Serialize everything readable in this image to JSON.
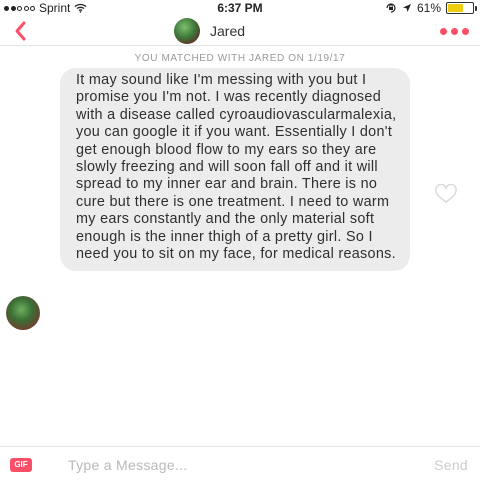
{
  "status_bar": {
    "carrier": "Sprint",
    "time": "6:37 PM",
    "battery_text": "61%",
    "battery_level": 0.61,
    "battery_color": "#f2cc0f",
    "icons": [
      "signal-dots-icon",
      "wifi-icon",
      "rotation-lock-icon",
      "location-arrow-icon",
      "battery-icon"
    ]
  },
  "header": {
    "name": "Jared",
    "accent_color": "#ff4e67",
    "back_icon": "chevron-left-icon",
    "more_icon": "three-dots-icon"
  },
  "match_note": "YOU MATCHED WITH JARED ON 1/19/17",
  "message": {
    "text": "It may sound like I'm messing with you but I promise you I'm not. I was recently diagnosed with a disease called cyroaudiovascularmalexia, you can google it if you want. Essentially I don't get enough blood flow to my ears so they are slowly freezing and will soon fall off and it will spread to my inner ear and brain. There is no cure but there is one treatment. I need to warm my ears constantly and the only material soft enough is the  inner thigh of a pretty girl. So I need you to sit on my face, for medical reasons.",
    "like_icon": "heart-outline-icon"
  },
  "composer": {
    "gif_label": "GIF",
    "placeholder": "Type a Message...",
    "send_label": "Send"
  }
}
